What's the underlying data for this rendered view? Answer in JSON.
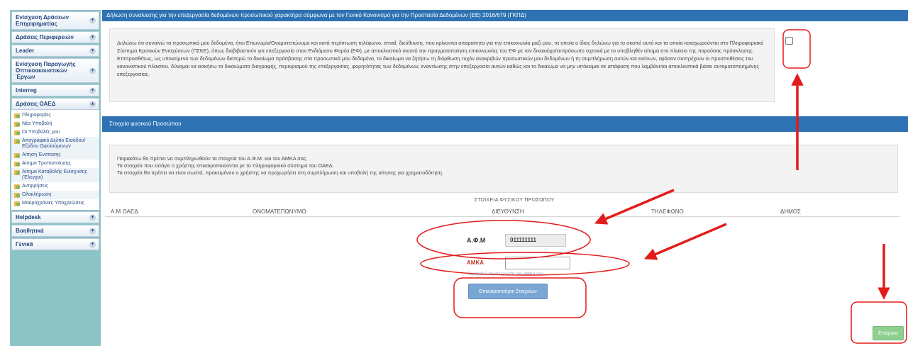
{
  "sidebar": {
    "groups_top": [
      {
        "label": "Ενίσχυση Δράσεων Επιχειρηματίας"
      },
      {
        "label": "Δράσεις Περιφερειών"
      },
      {
        "label": "Leader"
      },
      {
        "label": "Ενίσχυση Παραγωγής Οπτικοακουστικών Έργων"
      },
      {
        "label": "Interreg"
      }
    ],
    "open_group": {
      "label": "Δράσεις ΟΑΕΔ"
    },
    "items": [
      {
        "label": "Πληροφορίες"
      },
      {
        "label": "Νέα Υποβολή"
      },
      {
        "label": "Οι Υποβολές μου"
      },
      {
        "label": "Απογραφικό Δελτίο Εισόδου/Εξόδου Ωφελούμενων"
      },
      {
        "label": "Αίτηση Ένστασης"
      },
      {
        "label": "Αίτημα Τροποποίησης"
      },
      {
        "label": "Αίτημα Καταβολής Ενίσχυσης (Έλεγχοι)"
      },
      {
        "label": "Αντιρρήσεις"
      },
      {
        "label": "Ολοκλήρωση"
      },
      {
        "label": "Μακροχρόνιες Υποχρεώσεις"
      }
    ],
    "groups_bottom": [
      {
        "label": "Helpdesk"
      },
      {
        "label": "Βοηθητικά"
      },
      {
        "label": "Γενικά"
      }
    ]
  },
  "consent": {
    "title": "Δήλωση συναίνεσης για την επεξεργασία δεδομένων προσωπικού χαρακτήρα σύμφωνα με τον Γενικό Κανονισμό για την Προστασία Δεδομένων (ΕΕ) 2016/679 (ΓΚΠΔ)",
    "text": "Δηλώνω ότι συναινώ τα προσωπικά μου δεδομένα, ήτοι Επωνυμία/Ονοματεπώνυμο και κατά περίπτωση τηλέφωνο, email, διεύθυνση, που κρίνονται απαραίτητα για την επικοινωνία μαζί μου, τα οποία ο ίδιος δηλώνω για το σκοπό αυτό και τα οποία καταχωρούνται στο Πληροφοριακό Σύστημα Κρατικών Ενισχύσεων (ΠΣΚΕ), όπως διαβιβαστούν για επεξεργασία στον Ενδιάμεσο Φορέα (ΕΦ), με αποκλειστικό σκοπό την πραγματοποίηση επικοινωνίας του ΕΦ με τον δικαιούχο/εκπρόσωπο σχετικά με το υποβληθέν αίτημα στο πλαίσιο της παρούσας πρόσκλησης. Επιπροσθέτως, ως υποκείμενο των δεδομένων διατηρώ το δικαίωμα πρόσβασης στα προσωπικά μου δεδομένα, το δικαίωμα να ζητήσω τη διόρθωση τυχόν ανακριβών προσωπικών μου δεδομένων ή τη συμπλήρωση αυτών και εκείνων, εφόσον συντρέχουν οι προϋποθέσεις του κανονιστικού πλαισίου, δύναμαι να ασκήσω τα δικαιώματα διαγραφής, περιορισμού της επεξεργασίας, φορητότητας των δεδομένων, εναντίωσης στην επεξεργασία αυτών καθώς και το δικαίωμα να μην υπόκειμαι σε απόφαση που λαμβάνεται αποκλειστικά βάσει αυτοματοποιημένης επεξεργασίας."
  },
  "personal": {
    "section_title": "Στοιχεία φυσικού Προσώπου",
    "info_lines": [
      "Παρακάτω θα πρέπει να συμπληρωθούν τα στοιχεία του Α.Φ.Μ. και του ΑΜΚΑ σας.",
      "Τα στοιχεία που εισάγει ο χρήστης επικαιροποιούνται με το πληροφοριακό σύστημα του ΟΑΕΔ.",
      "Τα στοιχεία θα πρέπει να είναι σωστά, προκειμένου ο χρήστης να προχωρήσει στη συμπλήρωση και υποβολή της αίτησης για χρηματοδότηση."
    ],
    "table_title": "ΣΤΟΙΧΕΙΑ ΦΥΣΙΚΟΥ ΠΡΟΣΩΠΟΥ",
    "columns": [
      "Α.Μ ΟΑΕΔ",
      "ΟΝΟΜΑΤΕΠΩΝΥΜΟ",
      "ΔΙΕΥΘΥΝΣΗ",
      "ΤΗΛΕΦΩΝΟ",
      "ΔΗΜΟΣ"
    ],
    "afm_label": "Α.Φ.Μ",
    "afm_value": "011111111",
    "amka_label": "ΑΜΚΑ",
    "amka_value": "",
    "amka_hint": "Παρακαλώ συμπληρώστε τον ΑΜΚΑ σας",
    "update_button": "Επικαιροποίηση Στοιχείων"
  },
  "footer": {
    "next_button": "Επόμενο"
  },
  "colors": {
    "header_blue": "#2e72b3",
    "annotation_red": "#e31b1b",
    "next_green": "#8ecf8e",
    "sidebar_teal": "#8cc4c6"
  }
}
